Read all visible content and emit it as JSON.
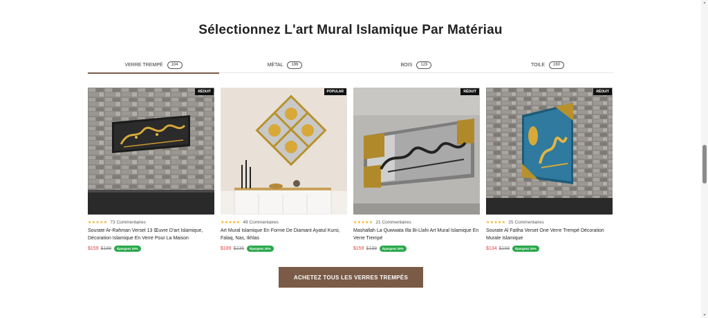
{
  "section": {
    "title": "Sélectionnez L'art Mural Islamique Par Matériau"
  },
  "tabs": [
    {
      "label": "VERRE TREMPÉ",
      "count": "104",
      "active": true
    },
    {
      "label": "MÉTAL",
      "count": "196",
      "active": false
    },
    {
      "label": "BOIS",
      "count": "123",
      "active": false
    },
    {
      "label": "TOILE",
      "count": "160",
      "active": false
    }
  ],
  "products": [
    {
      "badge": "RÉDUIT",
      "stars": "★★★★★",
      "reviews": "73 Commentaires",
      "title": "Sourate Ar-Rahman Verset 13 Œuvre D'art Islamique, Décoration Islamique En Verre Pour La Maison",
      "price": "$159",
      "old_price": "$199",
      "save": "Épargnez 20%"
    },
    {
      "badge": "POPULAR",
      "stars": "★★★★★",
      "reviews": "49 Commentaires",
      "title": "Art Mural Islamique En Forme De Diamant Ayatul Kursi, Falaq, Nas, Ikhlas",
      "price": "$189",
      "old_price": "$236",
      "save": "Épargnez 20%"
    },
    {
      "badge": "RÉDUIT",
      "stars": "★★★★★",
      "reviews": "21 Commentaires",
      "title": "Mashallah La Quwwata Illa Bi-Llahi Art Mural Islamique En Verre Trempé",
      "price": "$159",
      "old_price": "$199",
      "save": "Épargnez 20%"
    },
    {
      "badge": "RÉDUIT",
      "stars": "★★★★★",
      "reviews": "25 Commentaires",
      "title": "Sourate Al Fatiha Verset One Verre Trempé Décoration Murale Islamique",
      "price": "$134",
      "old_price": "$168",
      "save": "Épargnez 20%"
    }
  ],
  "cta": {
    "label": "ACHETEZ TOUS LES VERRES TREMPÉS"
  },
  "colors": {
    "accent": "#7a5b47",
    "sale": "#e0403a",
    "save_badge": "#2aa84a",
    "stars": "#f2b01e"
  }
}
